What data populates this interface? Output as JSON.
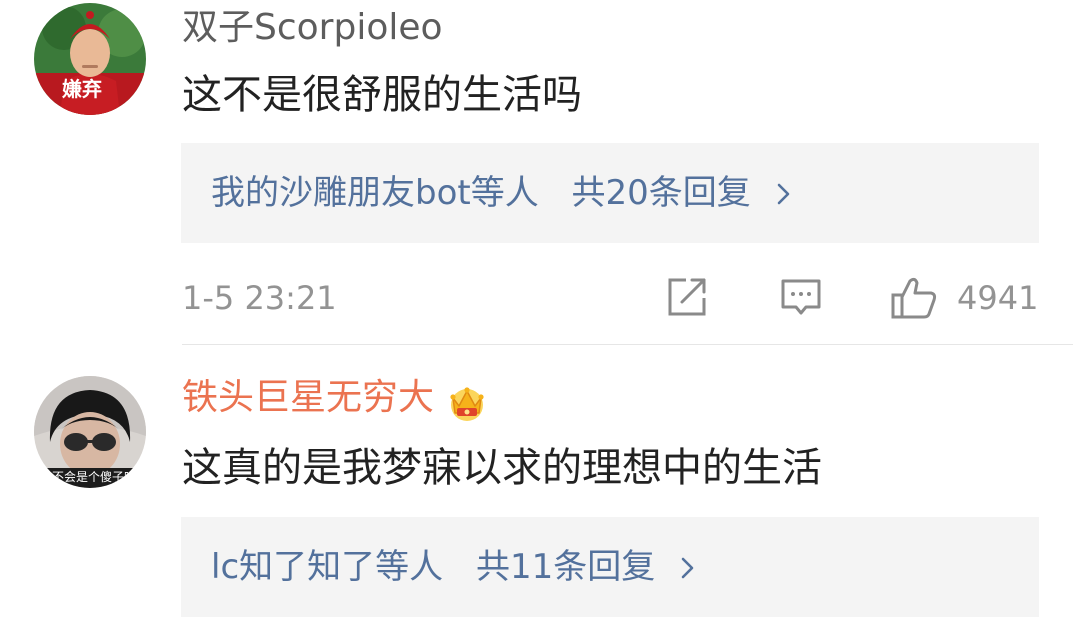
{
  "comments": [
    {
      "username": "双子Scorpioleo",
      "username_color": "#5d5d5d",
      "avatar_badge": "嫌弃",
      "text": "这不是很舒服的生活吗",
      "replies_summary": {
        "names": "我的沙雕朋友bot等人",
        "count_label": "共20条回复",
        "chevron_icon": "chevron-right-icon"
      },
      "timestamp": "1-5 23:21",
      "actions": {
        "repost_icon": "repost-icon",
        "comment_icon": "comment-icon",
        "like_icon": "thumbs-up-icon",
        "like_count": "4941"
      }
    },
    {
      "username": "铁头巨星无穷大",
      "username_color": "#eb7350",
      "vip_icon": "crown-icon",
      "avatar_caption": "孩不会是个傻子吧",
      "text": "这真的是我梦寐以求的理想中的生活",
      "replies_summary": {
        "names": "lc知了知了等人",
        "count_label": "共11条回复",
        "chevron_icon": "chevron-right-icon"
      }
    }
  ],
  "colors": {
    "link_blue": "#53719c",
    "meta_gray": "#939393",
    "reply_bg": "#f4f4f4",
    "vip_orange": "#eb7350"
  }
}
